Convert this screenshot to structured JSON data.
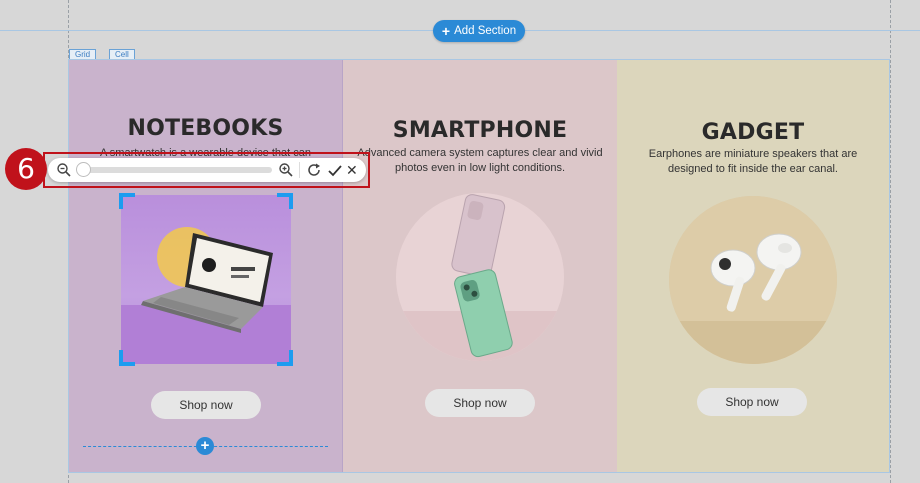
{
  "editor": {
    "add_section_label": "Add Section",
    "grid_tag": "Grid",
    "cell_tag": "Cell"
  },
  "columns": [
    {
      "heading": "NOTEBOOKS",
      "description": "A smartwatch is a wearable device that can",
      "button": "Shop now"
    },
    {
      "heading": "SMARTPHONE",
      "description": "Advanced camera system captures clear and vivid photos even in low light conditions.",
      "button": "Shop now"
    },
    {
      "heading": "GADGET",
      "description": "Earphones are miniature speakers that are designed to fit inside the ear canal.",
      "button": "Shop now"
    }
  ],
  "image_toolbar": {
    "zoom_level": 0,
    "icons": [
      "zoom-out-icon",
      "zoom-in-icon",
      "reset-icon",
      "check-icon",
      "close-icon"
    ],
    "cancel_glyph": "✕"
  },
  "annotation": {
    "step_number": "6",
    "color": "#c0121b"
  },
  "colors": {
    "accent": "#2b8ad6",
    "col1_bg": "#c9b3cc",
    "col2_bg": "#dcc7c9",
    "col3_bg": "#dcd6bc"
  }
}
